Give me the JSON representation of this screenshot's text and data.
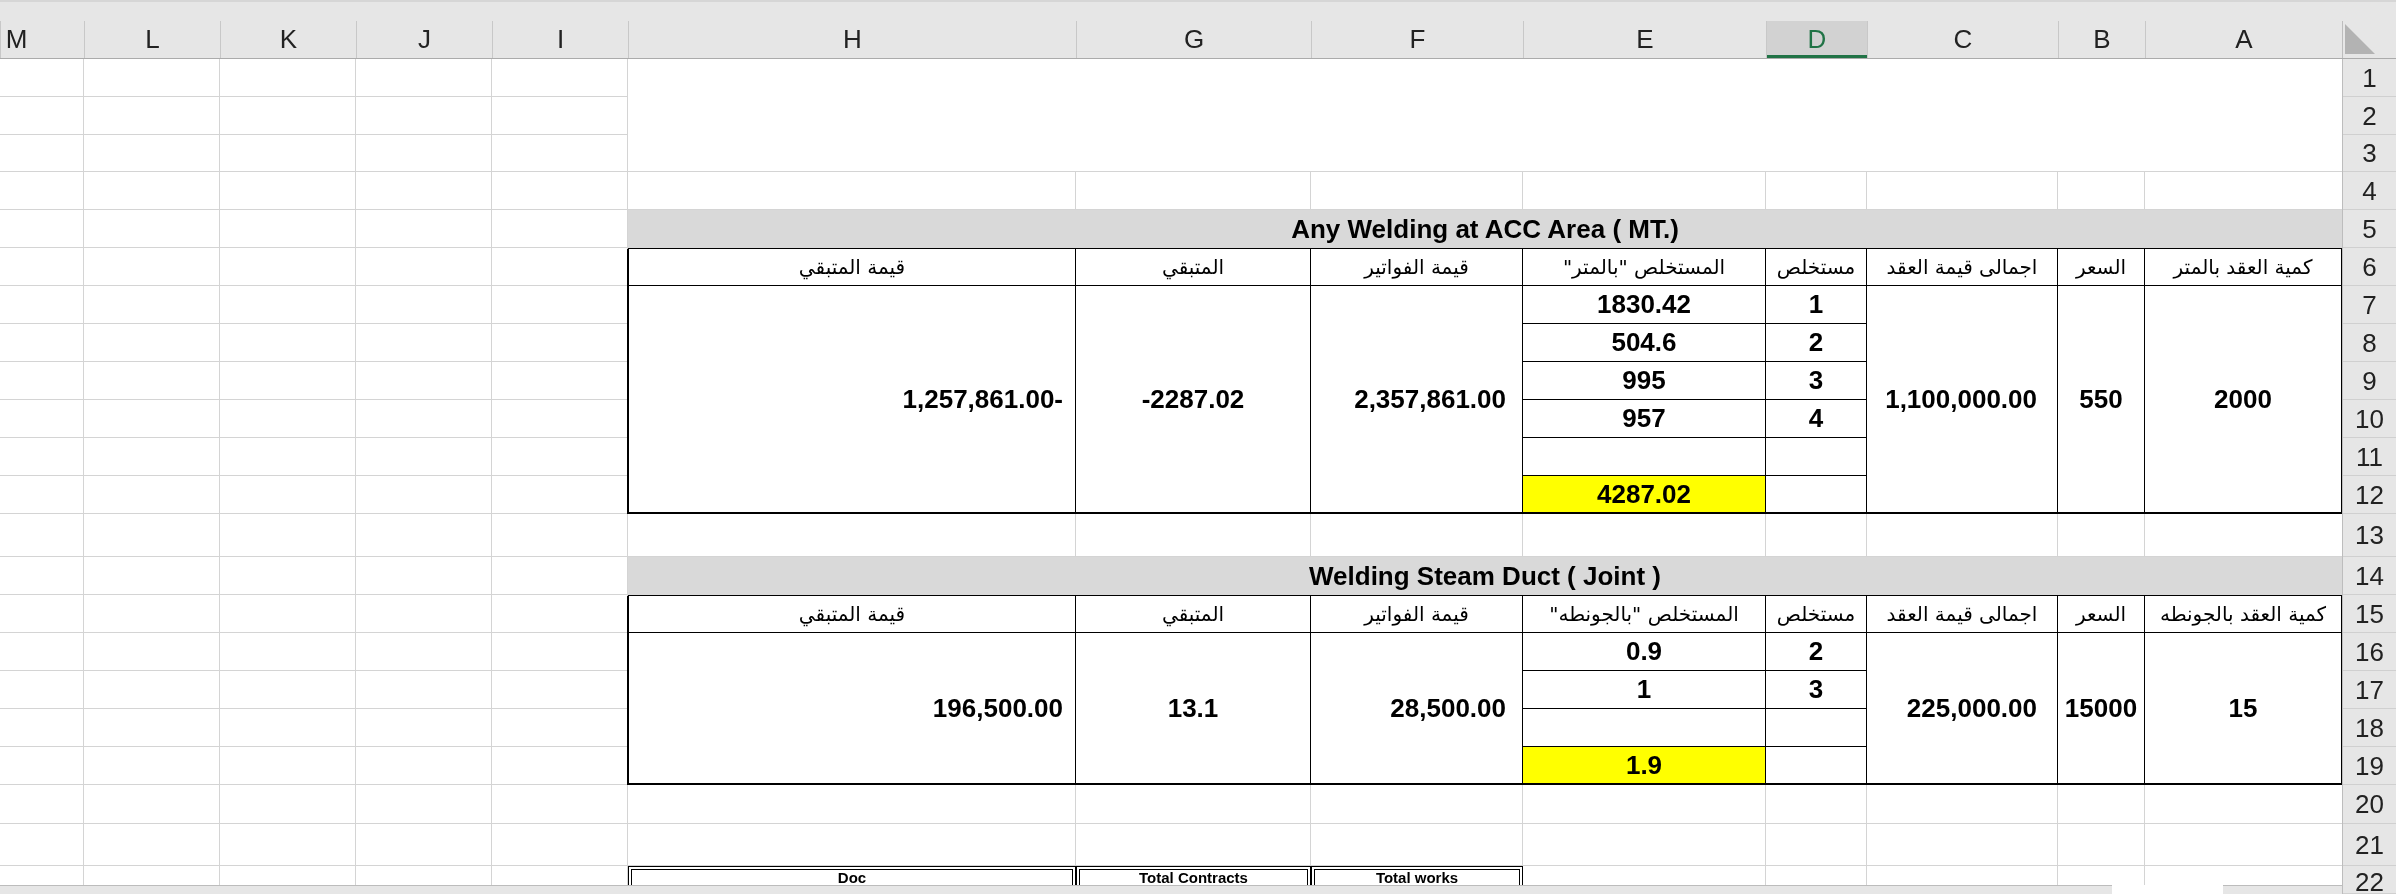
{
  "column_headers": [
    {
      "label": "A",
      "selected": false
    },
    {
      "label": "B",
      "selected": false
    },
    {
      "label": "C",
      "selected": false
    },
    {
      "label": "D",
      "selected": true
    },
    {
      "label": "E",
      "selected": false
    },
    {
      "label": "F",
      "selected": false
    },
    {
      "label": "G",
      "selected": false
    },
    {
      "label": "H",
      "selected": false
    },
    {
      "label": "I",
      "selected": false
    },
    {
      "label": "J",
      "selected": false
    },
    {
      "label": "K",
      "selected": false
    },
    {
      "label": "L",
      "selected": false
    },
    {
      "label": "M",
      "selected": false
    }
  ],
  "row_numbers": [
    "1",
    "2",
    "3",
    "4",
    "5",
    "6",
    "7",
    "8",
    "9",
    "10",
    "11",
    "12",
    "13",
    "14",
    "15",
    "16",
    "17",
    "18",
    "19",
    "20",
    "21",
    "22"
  ],
  "tables": [
    {
      "title": "Any Welding at ACC Area ( MT.)",
      "headers": [
        "كمية العقد بالمتر",
        "السعر",
        "اجمالى قيمة العقد",
        "مستخلص",
        "المستخلص \"بالمتر\"",
        "قيمة الفواتير",
        "المتبقي",
        "قيمة المتبقي"
      ],
      "quantity": "2000",
      "price": "550",
      "contract_value": "1,100,000.00",
      "entries": [
        {
          "kind": "entry",
          "number": "1",
          "quantity": "1830.42"
        },
        {
          "kind": "entry",
          "number": "2",
          "quantity": "504.6"
        },
        {
          "kind": "entry",
          "number": "3",
          "quantity": "995"
        },
        {
          "kind": "entry",
          "number": "4",
          "quantity": "957"
        },
        {
          "kind": "blank"
        },
        {
          "kind": "total",
          "quantity": "4287.02"
        }
      ],
      "invoice_value": "2,357,861.00",
      "remaining": "-2287.02",
      "remaining_value": "1,257,861.00-"
    },
    {
      "title": "Welding Steam Duct ( Joint )",
      "headers": [
        "كمية العقد بالجونطه",
        "السعر",
        "اجمالى قيمة العقد",
        "مستخلص",
        "المستخلص \"بالجونطه\"",
        "قيمة الفواتير",
        "المتبقي",
        "قيمة المتبقي"
      ],
      "quantity": "15",
      "price": "15000",
      "contract_value": "225,000.00",
      "entries": [
        {
          "kind": "entry",
          "number": "2",
          "quantity": "0.9"
        },
        {
          "kind": "entry",
          "number": "3",
          "quantity": "1"
        },
        {
          "kind": "blank"
        },
        {
          "kind": "total",
          "quantity": "1.9"
        }
      ],
      "invoice_value": "28,500.00",
      "remaining": "13.1",
      "remaining_value": "196,500.00"
    }
  ],
  "summary_table": {
    "headers": [
      "Total works",
      "Total Contracts",
      "Doc"
    ]
  }
}
